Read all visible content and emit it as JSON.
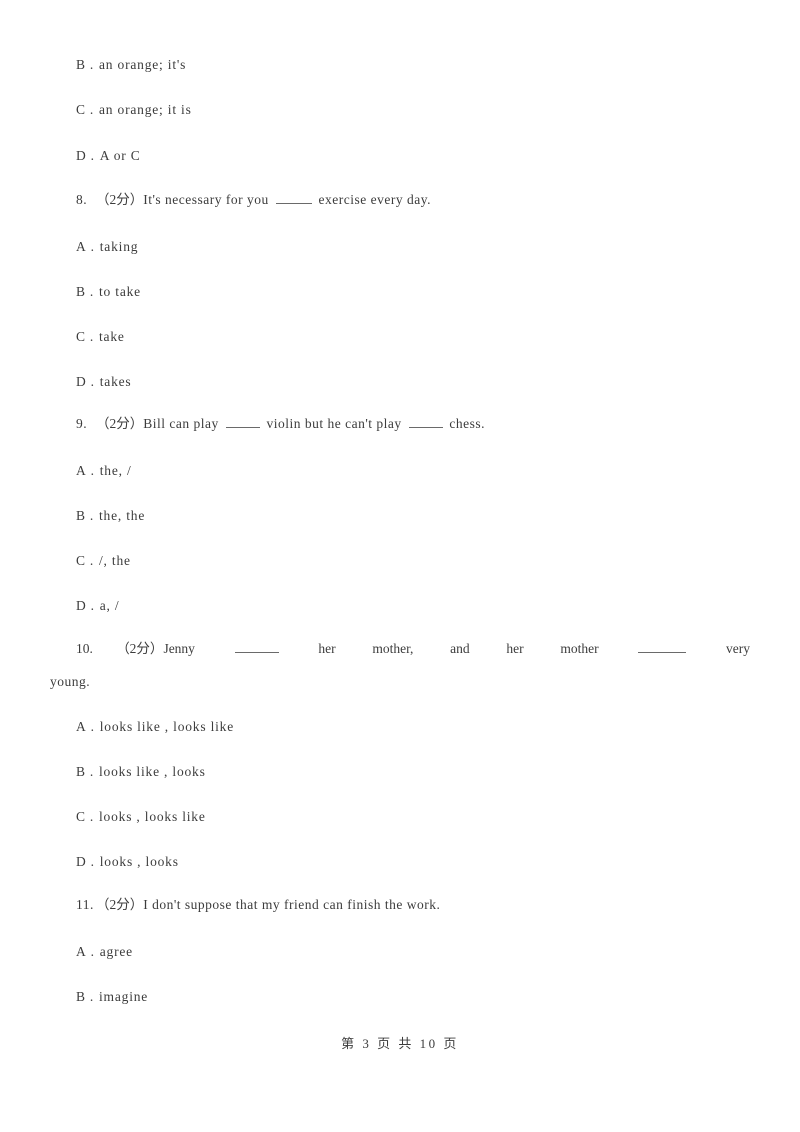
{
  "document": {
    "footer": "第 3 页 共 10 页",
    "page_number": "3",
    "total_pages": "10",
    "text_color": "#3c3c3c",
    "background_color": "#ffffff"
  },
  "orphan_options": [
    {
      "letter": "B",
      "dot": ".",
      "text": "an orange; it's"
    },
    {
      "letter": "C",
      "dot": ".",
      "text": "an orange; it is"
    },
    {
      "letter": "D",
      "dot": ".",
      "text": "A or C"
    }
  ],
  "questions": [
    {
      "number": "8.",
      "points": "（2分）",
      "stem_pre": "It's necessary for you ",
      "stem_post": " exercise every day.",
      "options": [
        {
          "letter": "A",
          "dot": ".",
          "text": "taking"
        },
        {
          "letter": "B",
          "dot": ".",
          "text": "to take"
        },
        {
          "letter": "C",
          "dot": ".",
          "text": "take"
        },
        {
          "letter": "D",
          "dot": ".",
          "text": "takes"
        }
      ]
    },
    {
      "number": "9.",
      "points": "（2分）",
      "stem_pre": "Bill can play ",
      "stem_mid": " violin but he can't play ",
      "stem_post": " chess.",
      "options": [
        {
          "letter": "A",
          "dot": ".",
          "text": "the, /"
        },
        {
          "letter": "B",
          "dot": ".",
          "text": "the, the"
        },
        {
          "letter": "C",
          "dot": ".",
          "text": "/, the"
        },
        {
          "letter": "D",
          "dot": ".",
          "text": "a, /"
        }
      ]
    },
    {
      "number": "10.",
      "points": "（2分）",
      "seg_jenny": "Jenny",
      "seg_her1": "her",
      "seg_mother1": "mother,",
      "seg_and": "and",
      "seg_her2": "her",
      "seg_mother2": "mother",
      "seg_very": "very",
      "continuation": "young.",
      "options": [
        {
          "letter": "A",
          "dot": ".",
          "text": "looks like , looks like"
        },
        {
          "letter": "B",
          "dot": ".",
          "text": "looks like , looks"
        },
        {
          "letter": "C",
          "dot": ".",
          "text": "looks , looks like"
        },
        {
          "letter": "D",
          "dot": ".",
          "text": "looks , looks"
        }
      ]
    },
    {
      "number": "11.",
      "points": "（2分）",
      "stem": "I don't suppose that my friend can finish the work.",
      "options": [
        {
          "letter": "A",
          "dot": ".",
          "text": "agree"
        },
        {
          "letter": "B",
          "dot": ".",
          "text": "imagine"
        }
      ]
    }
  ]
}
